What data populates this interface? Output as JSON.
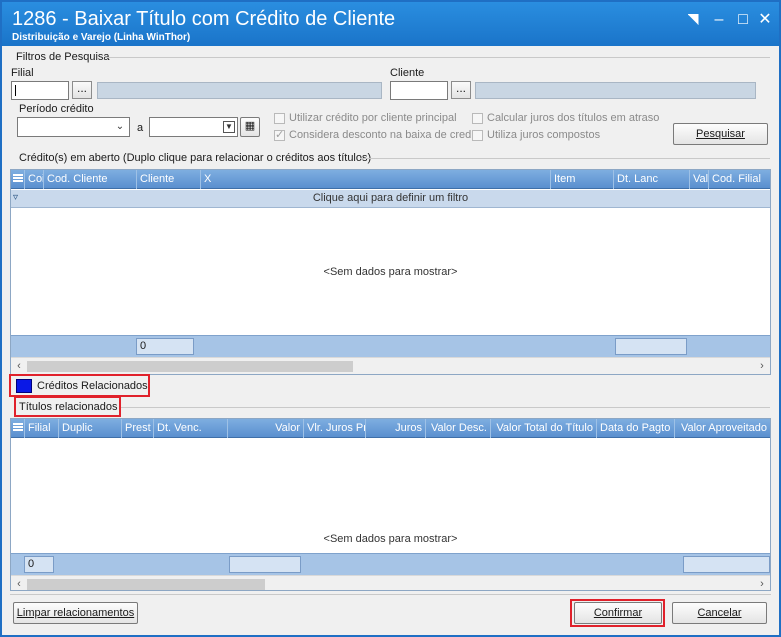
{
  "window": {
    "title": "1286 - Baixar Título com Crédito de Cliente",
    "subtitle": "Distribuição e Varejo (Linha WinThor)"
  },
  "filters": {
    "group_label": "Filtros de Pesquisa",
    "filial_label": "Filial",
    "filial_value": "",
    "cliente_label": "Cliente",
    "cliente_value": "",
    "periodo_label": "Período crédito",
    "periodo_a_label": "a",
    "ellipsis": "...",
    "chk_utilizar_credito": "Utilizar crédito por cliente principal",
    "chk_considera_desconto": "Considera desconto na baixa de cred.",
    "chk_calcular_juros": "Calcular juros dos títulos em atraso",
    "chk_juros_compostos": "Utiliza juros compostos",
    "chk_states": {
      "utilizar_credito": false,
      "considera_desconto": true,
      "calcular_juros": false,
      "juros_compostos": false
    },
    "pesquisar_button": "Pesquisar"
  },
  "creditos": {
    "group_label": "Crédito(s) em aberto  (Duplo clique para relacionar o créditos aos títulos)",
    "columns": [
      "Coi",
      "Cod. Cliente",
      "Cliente",
      "X",
      "Item",
      "Dt. Lanc",
      "Val",
      "Cod. Filial"
    ],
    "filter_text": "Clique aqui para definir um filtro",
    "empty_text": "<Sem dados para mostrar>",
    "footer_count": "0"
  },
  "relacionados": {
    "legend_label": "Créditos Relacionados",
    "legend_color": "#0a18e6",
    "group_label": "Títulos relacionados",
    "columns": [
      "Filial",
      "Duplic",
      "Prest",
      "Dt. Venc.",
      "Valor",
      "Vlr. Juros Pr",
      "Juros",
      "Valor Desc.",
      "Valor Total do Título",
      "Data do Pagto",
      "Valor Aproveitado"
    ],
    "empty_text": "<Sem dados para mostrar>",
    "footer_count": "0"
  },
  "actions": {
    "limpar_button": "Limpar relacionamentos",
    "confirmar_button": "Confirmar",
    "cancelar_button": "Cancelar"
  },
  "highlight_color": "#e0212b"
}
